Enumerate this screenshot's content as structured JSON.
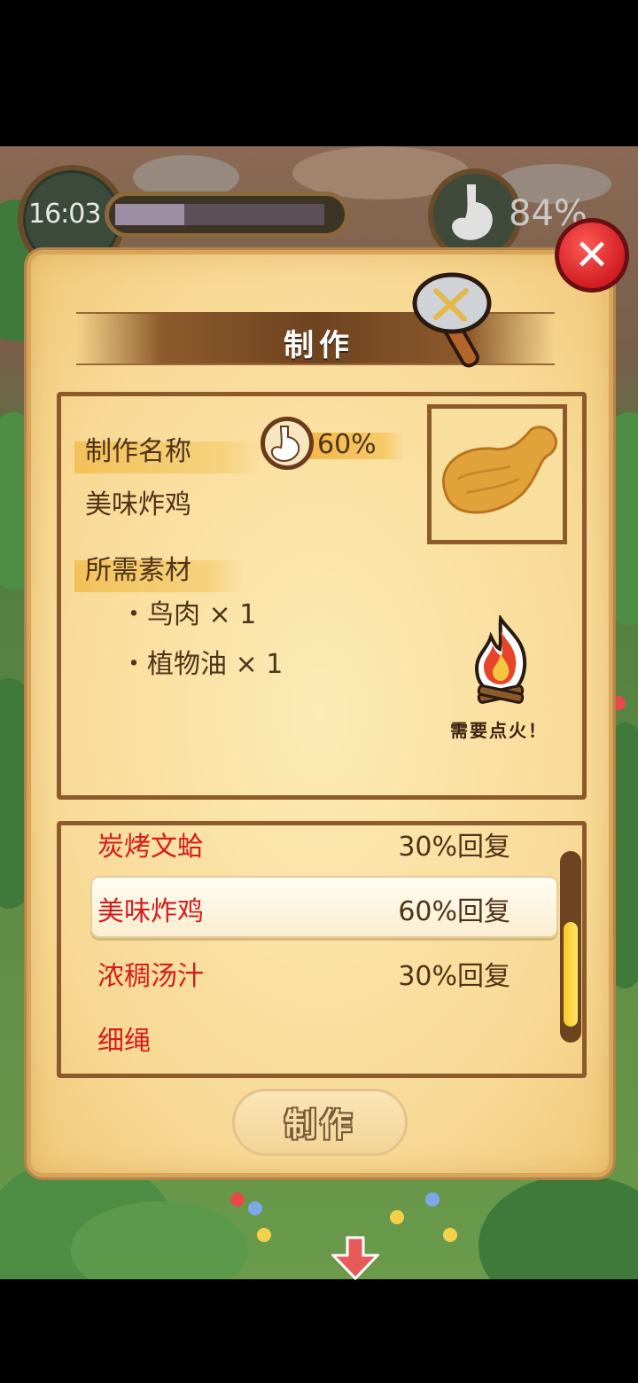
{
  "hud": {
    "time": "16:03",
    "time_progress": 0.33,
    "stomach_percent": "84%"
  },
  "dialog": {
    "title": "制作",
    "name_label": "制作名称",
    "recovery_percent": "60%",
    "item_name": "美味炸鸡",
    "materials_label": "所需素材",
    "materials": [
      "・鸟肉 × 1",
      "・植物油 × 1"
    ],
    "fire_note": "需要点火！",
    "make_button": "制作"
  },
  "recipes": [
    {
      "name": "炭烤文蛤",
      "recovery": "30%回复"
    },
    {
      "name": "美味炸鸡",
      "recovery": "60%回复",
      "selected": true
    },
    {
      "name": "浓稠汤汁",
      "recovery": "30%回复"
    },
    {
      "name": "细绳",
      "recovery": ""
    }
  ],
  "scroll_position": 0.55,
  "icons": {
    "close": "close-icon",
    "axe": "stone-axe-icon",
    "stomach": "stomach-icon",
    "fire": "campfire-icon",
    "food": "fried-chicken-icon",
    "arrow": "down-arrow-icon"
  },
  "colors": {
    "recipe_name": "#d61c1c",
    "panel_border": "#8d5a2b",
    "close_button": "#d11e22"
  }
}
